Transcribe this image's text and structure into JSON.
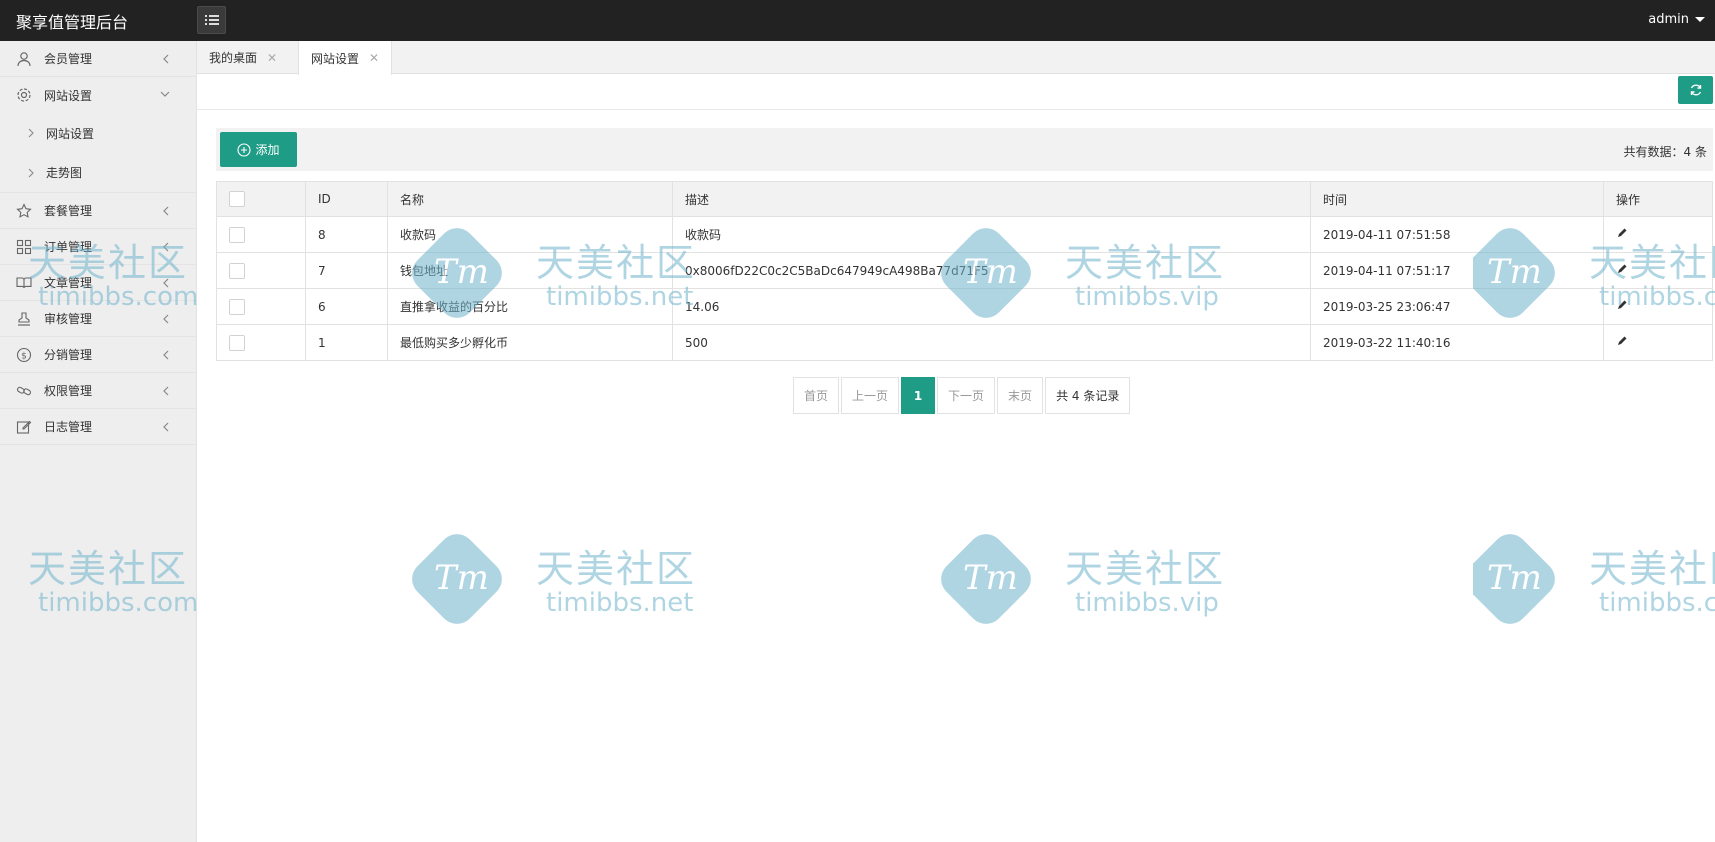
{
  "app": {
    "title": "聚享值管理后台",
    "user": "admin"
  },
  "sidebar": {
    "items": [
      {
        "label": "会员管理",
        "icon": "user-icon"
      },
      {
        "label": "网站设置",
        "icon": "gear-icon",
        "expanded": true,
        "children": [
          {
            "label": "网站设置"
          },
          {
            "label": "走势图"
          }
        ]
      },
      {
        "label": "套餐管理",
        "icon": "star-icon"
      },
      {
        "label": "订单管理",
        "icon": "grid-icon"
      },
      {
        "label": "文章管理",
        "icon": "book-icon"
      },
      {
        "label": "审核管理",
        "icon": "stamp-icon"
      },
      {
        "label": "分销管理",
        "icon": "dollar-icon"
      },
      {
        "label": "权限管理",
        "icon": "link-icon"
      },
      {
        "label": "日志管理",
        "icon": "edit-icon"
      }
    ]
  },
  "tabs": [
    {
      "label": "我的桌面",
      "active": false
    },
    {
      "label": "网站设置",
      "active": true
    }
  ],
  "toolbar": {
    "add_label": "添加",
    "count_text": "共有数据：4 条"
  },
  "table": {
    "columns": [
      "ID",
      "名称",
      "描述",
      "时间",
      "操作"
    ],
    "rows": [
      {
        "id": "8",
        "name": "收款码",
        "desc": "收款码",
        "time": "2019-04-11 07:51:58"
      },
      {
        "id": "7",
        "name": "钱包地址",
        "desc": "0x8006fD22C0c2C5BaDc647949cA498Ba77d71F5",
        "time": "2019-04-11 07:51:17"
      },
      {
        "id": "6",
        "name": "直推拿收益的百分比",
        "desc": "14.06",
        "time": "2019-03-25 23:06:47"
      },
      {
        "id": "1",
        "name": "最低购买多少孵化币",
        "desc": "500",
        "time": "2019-03-22 11:40:16"
      }
    ]
  },
  "pagination": {
    "first": "首页",
    "prev": "上一页",
    "current": "1",
    "next": "下一页",
    "last": "末页",
    "total": "共 4 条记录"
  },
  "watermark": {
    "logo_text": "Tm",
    "name": "天美社区",
    "urls": [
      "timibbs.com",
      "timibbs.net",
      "timibbs.vip"
    ]
  },
  "colors": {
    "accent": "#1f9c86",
    "topbar": "#222222",
    "sidebar": "#eeeeee"
  }
}
